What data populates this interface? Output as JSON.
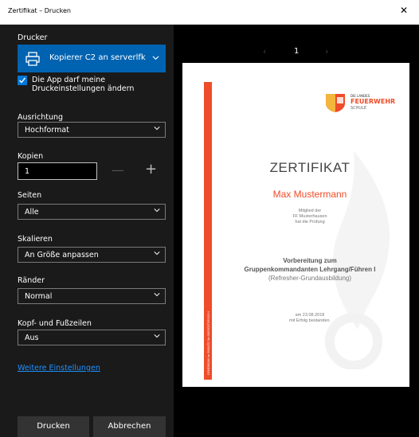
{
  "window": {
    "title": "Zertifikat – Drucken",
    "close_glyph": "✕"
  },
  "printer": {
    "label": "Drucker",
    "value": "Kopierer C2 an serverlfk",
    "icon": "printer-icon"
  },
  "app_settings": {
    "checked": true,
    "label": "Die App darf meine Druckeinstellungen ändern"
  },
  "orientation": {
    "label": "Ausrichtung",
    "value": "Hochformat"
  },
  "copies": {
    "label": "Kopien",
    "value": "1",
    "minus": "—",
    "plus": "+"
  },
  "pages": {
    "label": "Seiten",
    "value": "Alle"
  },
  "scale": {
    "label": "Skalieren",
    "value": "An Größe anpassen"
  },
  "margins": {
    "label": "Ränder",
    "value": "Normal"
  },
  "header_footer": {
    "label": "Kopf- und Fußzeilen",
    "value": "Aus"
  },
  "more_settings_link": "Weitere Einstellungen",
  "buttons": {
    "print": "Drucken",
    "cancel": "Abbrechen"
  },
  "preview": {
    "page_number": "1",
    "prev_glyph": "‹",
    "next_glyph": "›",
    "logo": {
      "line1": "DIE LANDES",
      "line2": "FEUERWEHR",
      "line3": "SCHULE"
    },
    "title": "ZERTIFIKAT",
    "name": "Max Mustermann",
    "member_lines": [
      "Mitglied der",
      "FF Musterhausen",
      "hat die Prüfung"
    ],
    "course_lines": [
      "Vorbereitung zum",
      "Gruppenkommandanten Lehrgang/Führen I"
    ],
    "course_sub": "(Refresher-Grundausbildung)",
    "date_lines": [
      "am 23.08.2018",
      "mit Erfolg bestanden."
    ],
    "side_text": "GEMEINSAM im EINSATZ für OBERÖSTERREICH"
  },
  "colors": {
    "accent": "#0078d7",
    "printer_bg": "#0063b1",
    "brand_red": "#ef4c29",
    "link": "#1e90ff"
  }
}
